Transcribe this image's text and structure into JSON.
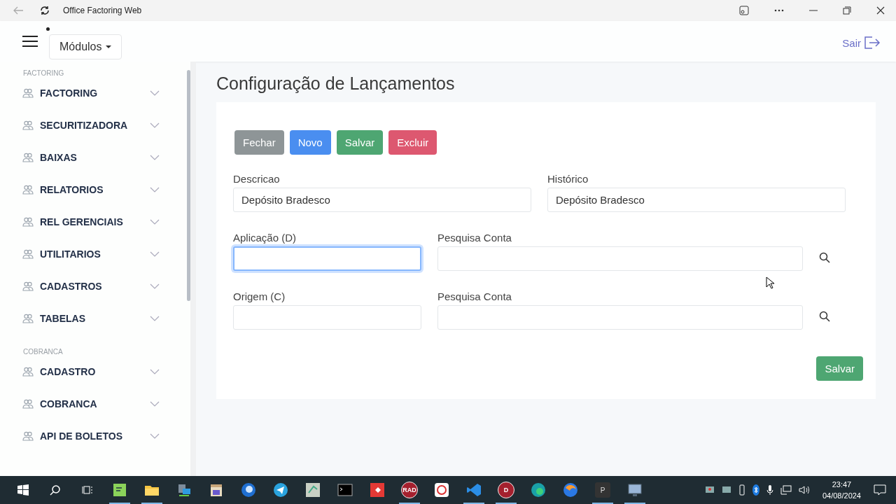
{
  "window": {
    "title": "Office Factoring Web"
  },
  "header": {
    "menu_button": "Módulos",
    "logout": "Sair"
  },
  "sidebar": {
    "sections": [
      {
        "title": "FACTORING",
        "items": [
          {
            "label": "FACTORING",
            "expanded": false
          },
          {
            "label": "SECURITIZADORA",
            "expanded": false
          },
          {
            "label": "BAIXAS",
            "expanded": false
          },
          {
            "label": "RELATORIOS",
            "expanded": false
          },
          {
            "label": "REL GERENCIAIS",
            "expanded": false
          },
          {
            "label": "UTILITARIOS",
            "expanded": false
          },
          {
            "label": "CADASTROS",
            "expanded": false
          },
          {
            "label": "TABELAS",
            "expanded": false
          }
        ]
      },
      {
        "title": "COBRANCA",
        "items": [
          {
            "label": "CADASTRO",
            "expanded": false
          },
          {
            "label": "COBRANCA",
            "expanded": false
          },
          {
            "label": "API DE BOLETOS",
            "expanded": false
          }
        ]
      }
    ]
  },
  "page": {
    "title": "Configuração de Lançamentos",
    "toolbar": [
      {
        "label": "Fechar",
        "kind": "secondary"
      },
      {
        "label": "Novo",
        "kind": "primary"
      },
      {
        "label": "Salvar",
        "kind": "success"
      },
      {
        "label": "Excluir",
        "kind": "danger"
      }
    ],
    "rows": [
      [
        {
          "label": "Descricao",
          "value": "Depósito Bradesco",
          "kind": "text",
          "focused": false
        },
        {
          "label": "Histórico",
          "value": "Depósito Bradesco",
          "kind": "text",
          "focused": false
        }
      ],
      [
        {
          "label": "Aplicação (D)",
          "kind": "short",
          "focused": true
        },
        {
          "label": "Pesquisa Conta",
          "kind": "search",
          "focused": false
        }
      ],
      [
        {
          "label": "Origem (C)",
          "kind": "short",
          "focused": false
        },
        {
          "label": "Pesquisa Conta",
          "kind": "search",
          "focused": false
        }
      ]
    ],
    "save_button": "Salvar"
  },
  "taskbar": {
    "apps": [
      {
        "kind": "notepad",
        "running": true
      },
      {
        "kind": "folder",
        "running": true
      },
      {
        "kind": "network",
        "running": false
      },
      {
        "kind": "calendar",
        "running": false
      },
      {
        "kind": "thunderbird",
        "running": false
      },
      {
        "kind": "telegram",
        "running": false
      },
      {
        "kind": "tool",
        "running": false
      },
      {
        "kind": "terminal",
        "running": false
      },
      {
        "kind": "anydesk",
        "running": false
      },
      {
        "kind": "badge",
        "label": "RAD",
        "running": true
      },
      {
        "kind": "bank",
        "running": false
      },
      {
        "kind": "vscode",
        "running": true
      },
      {
        "kind": "badge",
        "label": "D",
        "running": true
      },
      {
        "kind": "edge",
        "running": false
      },
      {
        "kind": "firefox",
        "running": false
      },
      {
        "kind": "square",
        "label": "P",
        "running": true
      },
      {
        "kind": "monitor",
        "running": true
      }
    ],
    "time": "23:47",
    "date": "04/08/2024"
  }
}
